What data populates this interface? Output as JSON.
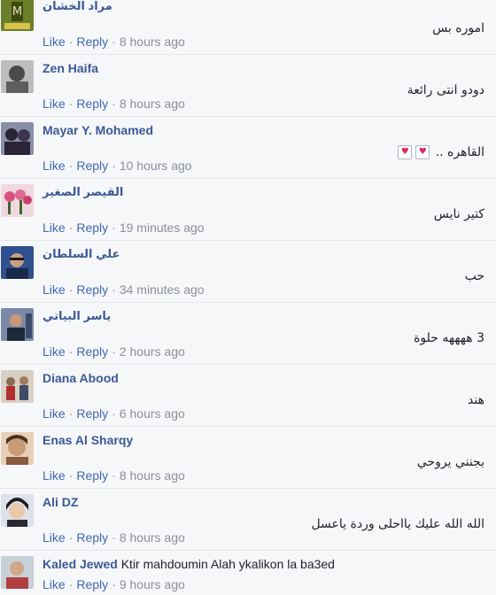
{
  "comments": [
    {
      "name": "مراد الخشان",
      "name_rtl": true,
      "text": "اموره بس",
      "like": "Like",
      "reply": "Reply",
      "time": "8 hours ago",
      "avatar_color": "#6b7f2a"
    },
    {
      "name": "Zen Haifa",
      "name_rtl": false,
      "text": "دودو انتى رائعة",
      "like": "Like",
      "reply": "Reply",
      "time": "8 hours ago",
      "avatar_color": "#5d5d5d"
    },
    {
      "name": "Mayar Y. Mohamed",
      "name_rtl": false,
      "text": "القاهره ..",
      "hearts": 2,
      "like": "Like",
      "reply": "Reply",
      "time": "10 hours ago",
      "avatar_color": "#3b3550"
    },
    {
      "name": "القيصر الصغير",
      "name_rtl": true,
      "text": "كتير نايس",
      "like": "Like",
      "reply": "Reply",
      "time": "19 minutes ago",
      "avatar_color": "#d9527f"
    },
    {
      "name": "علي السلطان",
      "name_rtl": true,
      "text": "حب",
      "like": "Like",
      "reply": "Reply",
      "time": "34 minutes ago",
      "avatar_color": "#2f4f8f"
    },
    {
      "name": "ياسر البياتي",
      "name_rtl": true,
      "text": "3 ههههه حلوة",
      "like": "Like",
      "reply": "Reply",
      "time": "2 hours ago",
      "avatar_color": "#3a4a6a"
    },
    {
      "name": "Diana Abood",
      "name_rtl": false,
      "text": "هند",
      "like": "Like",
      "reply": "Reply",
      "time": "6 hours ago",
      "avatar_color": "#8a7a6a"
    },
    {
      "name": "Enas Al Sharqy",
      "name_rtl": false,
      "text": "بجنني يروحي",
      "like": "Like",
      "reply": "Reply",
      "time": "8 hours ago",
      "avatar_color": "#c89a78"
    },
    {
      "name": "Ali DZ",
      "name_rtl": false,
      "text": "الله الله عليك يااحلى وردة ياعسل",
      "like": "Like",
      "reply": "Reply",
      "time": "8 hours ago",
      "avatar_color": "#2a2a34"
    },
    {
      "name": "Kaled Jewed",
      "name_rtl": false,
      "inline_text": "Ktir mahdoumin Alah ykalikon la ba3ed",
      "like": "Like",
      "reply": "Reply",
      "time": "9 hours ago",
      "avatar_color": "#b04040"
    }
  ]
}
